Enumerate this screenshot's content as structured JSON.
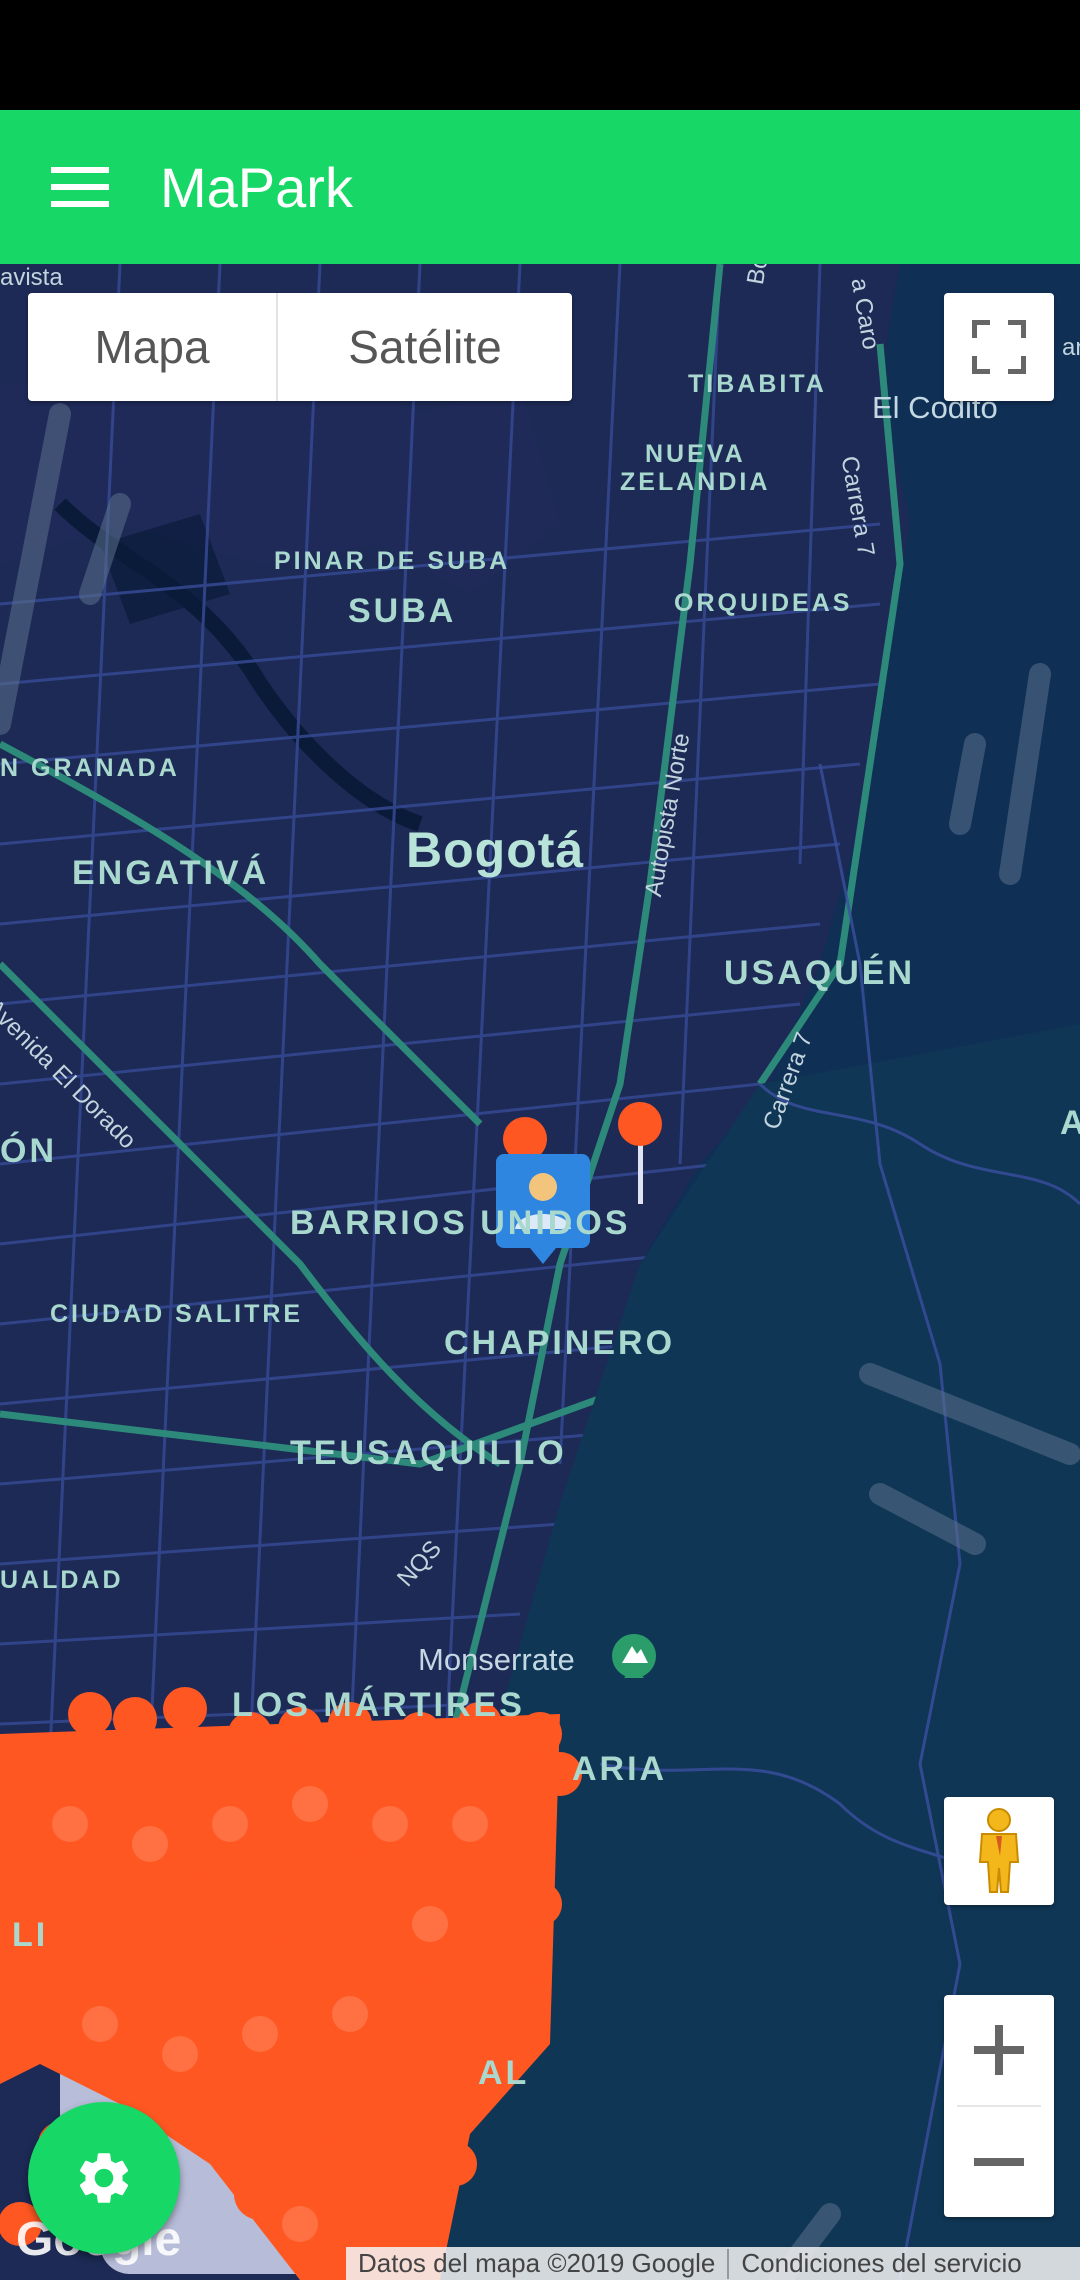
{
  "app": {
    "title": "MaPark"
  },
  "map_type": {
    "options": [
      "Mapa",
      "Satélite"
    ],
    "selected": "Mapa"
  },
  "labels": {
    "city": "Bogotá",
    "suba": "SUBA",
    "pinar": "PINAR DE SUBA",
    "granada": "N GRANADA",
    "engativa": "ENGATIVÁ",
    "tibabita": "TIBABITA",
    "nueva": "NUEVA",
    "zelandia": "ZELANDIA",
    "orquideas": "ORQUIDEAS",
    "usaquen": "USAQUÉN",
    "barrios": "BARRIOS UNIDOS",
    "chapinero": "CHAPINERO",
    "salitre": "CIUDAD SALITRE",
    "teusaquillo": "TEUSAQUILLO",
    "martires": "LOS MÁRTIRES",
    "ualdad": "UALDAD",
    "on": "ÓN",
    "aria": "ARIA",
    "al": "AL",
    "li": "LI",
    "avista": "avista",
    "an": "an",
    "a_right": "A"
  },
  "roads": {
    "autopista": "Autopista Norte",
    "carrera7a": "Carrera 7",
    "carrera7b": "Carrera 7",
    "dorado": "Avenida El Dorado",
    "bogota": "Bogotá",
    "caro": "a Caro",
    "nqs": "NQS"
  },
  "places": {
    "codito": "El Codito",
    "monserrate": "Monserrate"
  },
  "attribution": {
    "data": "Datos del mapa ©2019 Google",
    "terms": "Condiciones del servicio",
    "logo": "Google"
  },
  "colors": {
    "appbar": "#17d866",
    "map_bg": "#0f2f55",
    "marker": "#ff5722",
    "user_pin": "#2f86e0"
  },
  "icons": {
    "menu": "menu-icon",
    "fullscreen": "fullscreen-icon",
    "pegman": "pegman-icon",
    "settings": "gear-icon"
  },
  "zoom": {
    "in": "+",
    "out": "−"
  }
}
